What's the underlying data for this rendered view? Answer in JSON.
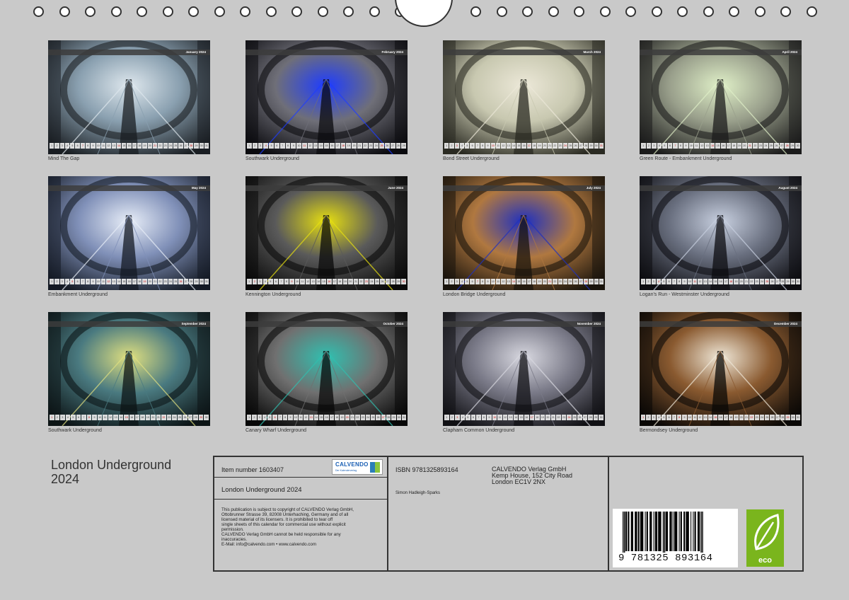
{
  "binding": {
    "hole_count_left": 16,
    "hole_count_right": 14
  },
  "months": [
    {
      "label": "January 2024",
      "caption": "Mind The Gap",
      "palette": [
        "#1a1e22",
        "#8aa0b0",
        "#dfe8ee"
      ]
    },
    {
      "label": "February 2024",
      "caption": "Southwark Underground",
      "palette": [
        "#0b0b0f",
        "#6f6f78",
        "#1e3cff"
      ]
    },
    {
      "label": "March 2024",
      "caption": "Bond Street Underground",
      "palette": [
        "#2a2a22",
        "#c8c8b0",
        "#ece8d8"
      ]
    },
    {
      "label": "April 2024",
      "caption": "Green Route - Embankment Underground",
      "palette": [
        "#1c1c1c",
        "#9aa08c",
        "#e0f0c8"
      ]
    },
    {
      "label": "May 2024",
      "caption": "Embankment Underground",
      "palette": [
        "#141a24",
        "#8090b8",
        "#e8eef8"
      ]
    },
    {
      "label": "June 2024",
      "caption": "Kennington Underground",
      "palette": [
        "#0a0a0a",
        "#5a5a5a",
        "#e8e010"
      ]
    },
    {
      "label": "July 2024",
      "caption": "London Bridge Underground",
      "palette": [
        "#1a140c",
        "#b07840",
        "#1e30c0"
      ]
    },
    {
      "label": "August 2024",
      "caption": "Logan's Run - Westminster Underground",
      "palette": [
        "#0c0c10",
        "#6a7080",
        "#c8d0e0"
      ]
    },
    {
      "label": "September 2024",
      "caption": "Southwark Underground",
      "palette": [
        "#0c1416",
        "#4a7a80",
        "#e0e080"
      ]
    },
    {
      "label": "October 2024",
      "caption": "Canary Wharf Underground",
      "palette": [
        "#080808",
        "#707070",
        "#30c0b0"
      ]
    },
    {
      "label": "November 2024",
      "caption": "Clapham Common Underground",
      "palette": [
        "#101014",
        "#7a7a88",
        "#d8d8e0"
      ]
    },
    {
      "label": "December 2024",
      "caption": "Bermondsey Underground",
      "palette": [
        "#0a0806",
        "#8a5a30",
        "#f0e8d8"
      ]
    }
  ],
  "title": "London Underground 2024",
  "info": {
    "item_number": "Item number 1603407",
    "logo_text": "CALVENDO",
    "logo_tagline": "Der Kalenderverlag",
    "subtitle": "London Underground 2024",
    "legal": [
      "This publication is subject to copyright of CALVENDO Verlag GmbH,",
      "Ottobrunner Strasse 39, 82008 Unterhaching, Germany and of all",
      "licensed material of its licensers. It is prohibited to tear off",
      "single sheets of this calendar for commercial use without explicit",
      "permission.",
      "CALVENDO Verlag GmbH cannot be held responsible for any",
      "inaccuracies.",
      "E-Mail: info@calvendo.com • www.calvendo.com"
    ],
    "isbn": "ISBN 9781325893164",
    "publisher": [
      "CALVENDO Verlag GmbH",
      "Kemp House, 152 City Road",
      "London EC1V 2NX"
    ],
    "author": "Simon Hadleigh-Sparks",
    "barcode_number": "9 781325 893164",
    "eco_label": "eco"
  },
  "colors": {
    "background": "#c9c9c9",
    "border": "#333333",
    "eco_green": "#7ab51d",
    "calvendo_blue": "#1a5fb4"
  }
}
